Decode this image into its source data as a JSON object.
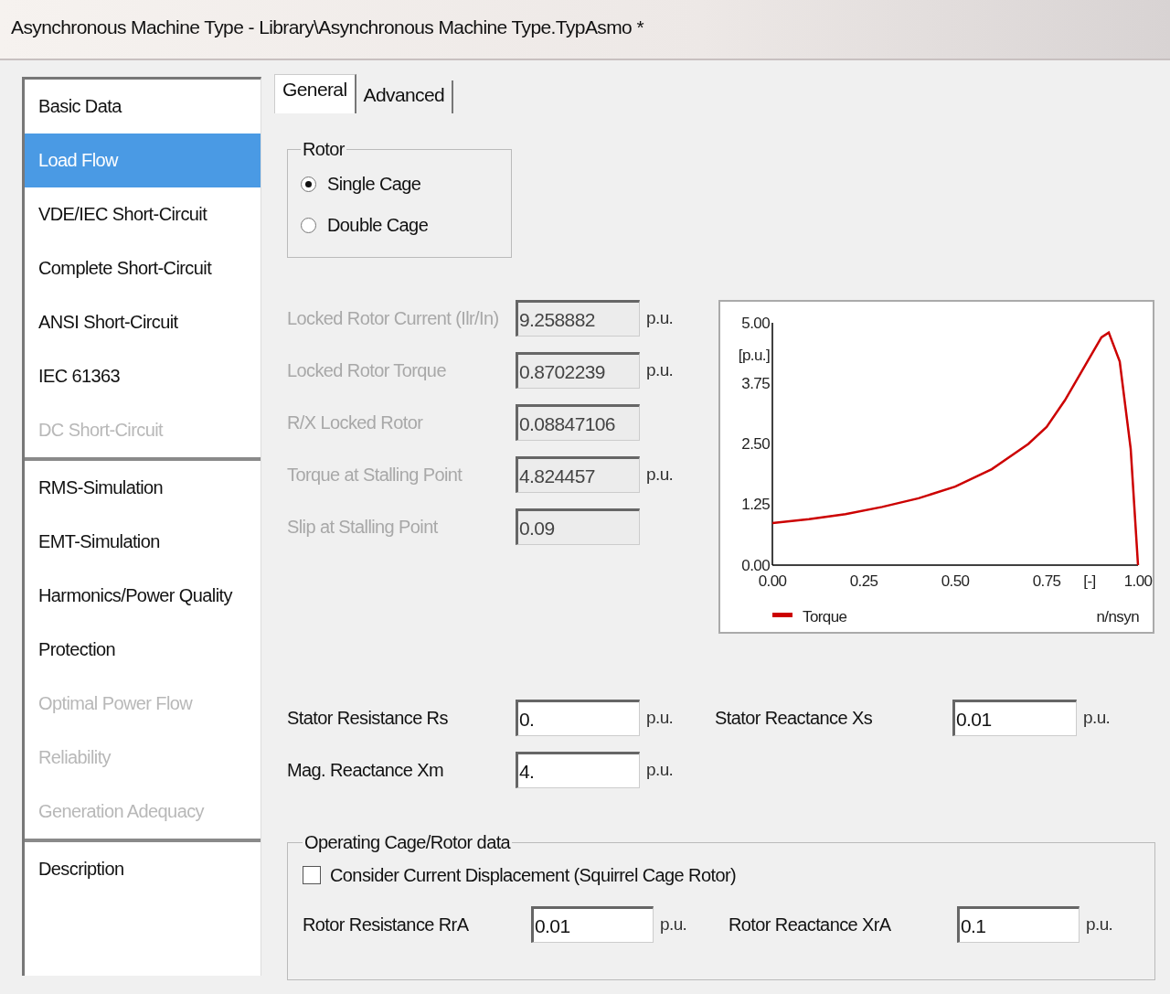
{
  "window": {
    "title": "Asynchronous Machine Type - Library\\Asynchronous Machine Type.TypAsmo *"
  },
  "sidebar": {
    "groups": [
      [
        {
          "label": "Basic Data",
          "selected": false,
          "disabled": false
        },
        {
          "label": "Load Flow",
          "selected": true,
          "disabled": false
        },
        {
          "label": "VDE/IEC Short-Circuit",
          "selected": false,
          "disabled": false
        },
        {
          "label": "Complete Short-Circuit",
          "selected": false,
          "disabled": false
        },
        {
          "label": "ANSI Short-Circuit",
          "selected": false,
          "disabled": false
        },
        {
          "label": "IEC 61363",
          "selected": false,
          "disabled": false
        },
        {
          "label": "DC Short-Circuit",
          "selected": false,
          "disabled": true
        }
      ],
      [
        {
          "label": "RMS-Simulation",
          "selected": false,
          "disabled": false
        },
        {
          "label": "EMT-Simulation",
          "selected": false,
          "disabled": false
        },
        {
          "label": "Harmonics/Power Quality",
          "selected": false,
          "disabled": false
        },
        {
          "label": "Protection",
          "selected": false,
          "disabled": false
        },
        {
          "label": "Optimal Power Flow",
          "selected": false,
          "disabled": true
        },
        {
          "label": "Reliability",
          "selected": false,
          "disabled": true
        },
        {
          "label": "Generation Adequacy",
          "selected": false,
          "disabled": true
        }
      ],
      [
        {
          "label": "Description",
          "selected": false,
          "disabled": false
        }
      ]
    ]
  },
  "tabs": [
    {
      "label": "General",
      "selected": true
    },
    {
      "label": "Advanced",
      "selected": false
    }
  ],
  "rotor": {
    "title": "Rotor",
    "options": [
      {
        "label": "Single Cage",
        "selected": true
      },
      {
        "label": "Double Cage",
        "selected": false
      }
    ]
  },
  "computed_fields": [
    {
      "label": "Locked Rotor Current (Ilr/In)",
      "value": "9.258882",
      "unit": "p.u.",
      "disabled": true
    },
    {
      "label": "Locked Rotor Torque",
      "value": "0.8702239",
      "unit": "p.u.",
      "disabled": true
    },
    {
      "label": "R/X Locked Rotor",
      "value": "0.08847106",
      "disabled": true
    },
    {
      "label": "Torque at Stalling Point",
      "value": "4.824457",
      "unit": "p.u.",
      "disabled": true
    },
    {
      "label": "Slip at Stalling Point",
      "value": "0.09",
      "disabled": true
    }
  ],
  "chart": {
    "x_unit": "[-]",
    "chart_data": {
      "type": "line",
      "xlabel": "n/nsyn",
      "ylabel": "[p.u.]",
      "x": [
        0,
        0.1,
        0.2,
        0.3,
        0.4,
        0.5,
        0.6,
        0.7,
        0.75,
        0.8,
        0.85,
        0.9,
        0.92,
        0.95,
        0.98,
        1.0
      ],
      "series": [
        {
          "name": "Torque",
          "color": "#cc0000",
          "values": [
            0.87,
            0.95,
            1.05,
            1.2,
            1.38,
            1.62,
            1.98,
            2.5,
            2.85,
            3.4,
            4.05,
            4.7,
            4.8,
            4.2,
            2.4,
            0
          ]
        }
      ],
      "xlim": [
        0,
        1
      ],
      "ylim": [
        0,
        5
      ],
      "xticks": [
        {
          "value": 0,
          "label": "0.00"
        },
        {
          "value": 0.25,
          "label": "0.25"
        },
        {
          "value": 0.5,
          "label": "0.50"
        },
        {
          "value": 0.75,
          "label": "0.75"
        },
        {
          "value": 1,
          "label": "1.00"
        }
      ],
      "yticks": [
        {
          "value": 0,
          "label": "0.00"
        },
        {
          "value": 1.25,
          "label": "1.25"
        },
        {
          "value": 2.5,
          "label": "2.50"
        },
        {
          "value": 3.75,
          "label": "3.75"
        },
        {
          "value": 5,
          "label": "5.00"
        }
      ]
    }
  },
  "stator_fields": [
    [
      {
        "label": "Stator Resistance Rs",
        "value": "0.",
        "unit": "p.u."
      },
      {
        "label": "Stator Reactance Xs",
        "value": "0.01",
        "unit": "p.u."
      }
    ],
    [
      {
        "label": "Mag. Reactance Xm",
        "value": "4.",
        "unit": "p.u."
      }
    ]
  ],
  "operating": {
    "title": "Operating Cage/Rotor data",
    "checkbox": {
      "label": "Consider Current Displacement (Squirrel Cage Rotor)",
      "checked": false
    },
    "fields": [
      {
        "label": "Rotor Resistance RrA",
        "value": "0.01",
        "unit": "p.u."
      },
      {
        "label": "Rotor Reactance XrA",
        "value": "0.1",
        "unit": "p.u."
      }
    ]
  }
}
